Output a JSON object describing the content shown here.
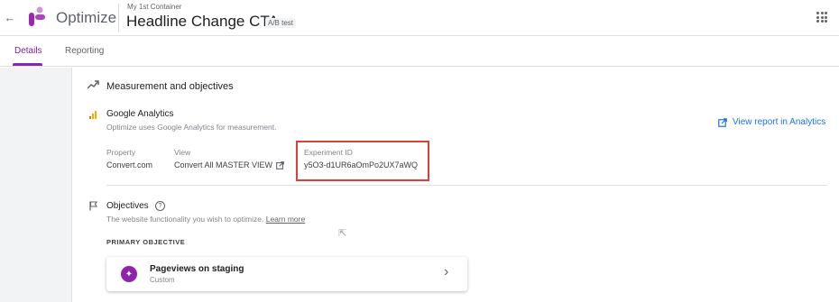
{
  "header": {
    "back_glyph": "←",
    "product_name": "Optimize",
    "container_name": "My 1st Container",
    "experiment_title": "Headline Change CTA",
    "experiment_type": "A/B test"
  },
  "tabs": [
    {
      "label": "Details",
      "active": true
    },
    {
      "label": "Reporting",
      "active": false
    }
  ],
  "measurement": {
    "section_title": "Measurement and objectives",
    "analytics_title": "Google Analytics",
    "analytics_subtitle": "Optimize uses Google Analytics for measurement.",
    "view_report_label": "View report in Analytics",
    "property_label": "Property",
    "property_value": "Convert.com",
    "view_label": "View",
    "view_value": "Convert All MASTER VIEW",
    "experiment_id_label": "Experiment ID",
    "experiment_id_value": "y5O3-d1UR6aOmPo2UX7aWQ"
  },
  "objectives": {
    "title": "Objectives",
    "subtitle": "The website functionality you wish to optimize.",
    "learn_more": "Learn more",
    "primary_label": "PRIMARY OBJECTIVE",
    "primary": {
      "name": "Pageviews on staging",
      "type": "Custom"
    }
  },
  "colors": {
    "accent": "#8e24aa",
    "link": "#1a73e8",
    "highlight_box": "#d9423b",
    "analytics_orange": "#f9ab00"
  },
  "icons": [
    "back-arrow-icon",
    "optimize-logo",
    "apps-grid-icon",
    "trending-icon",
    "analytics-icon",
    "external-link-icon",
    "flag-icon",
    "help-icon",
    "sparkle-icon",
    "chevron-right-icon"
  ]
}
